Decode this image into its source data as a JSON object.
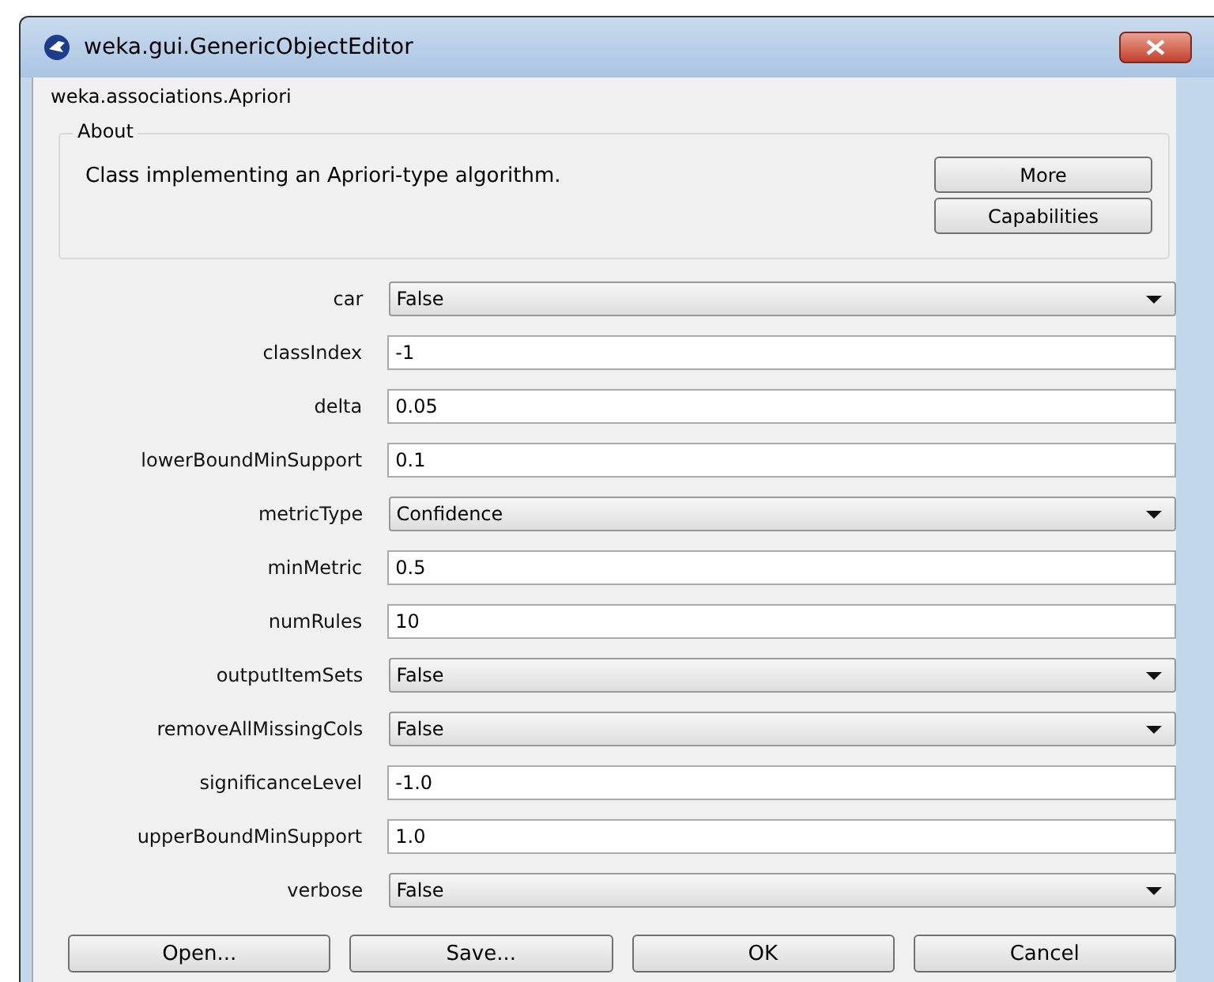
{
  "window": {
    "title": "weka.gui.GenericObjectEditor"
  },
  "class_name": "weka.associations.Apriori",
  "about": {
    "legend": "About",
    "description": "Class implementing an Apriori-type algorithm.",
    "buttons": [
      "More",
      "Capabilities"
    ]
  },
  "properties": [
    {
      "label": "car",
      "kind": "dropdown",
      "value": "False"
    },
    {
      "label": "classIndex",
      "kind": "text",
      "value": "-1"
    },
    {
      "label": "delta",
      "kind": "text",
      "value": "0.05"
    },
    {
      "label": "lowerBoundMinSupport",
      "kind": "text",
      "value": "0.1"
    },
    {
      "label": "metricType",
      "kind": "dropdown",
      "value": "Confidence"
    },
    {
      "label": "minMetric",
      "kind": "text",
      "value": "0.5"
    },
    {
      "label": "numRules",
      "kind": "text",
      "value": "10"
    },
    {
      "label": "outputItemSets",
      "kind": "dropdown",
      "value": "False"
    },
    {
      "label": "removeAllMissingCols",
      "kind": "dropdown",
      "value": "False"
    },
    {
      "label": "significanceLevel",
      "kind": "text",
      "value": "-1.0"
    },
    {
      "label": "upperBoundMinSupport",
      "kind": "text",
      "value": "1.0"
    },
    {
      "label": "verbose",
      "kind": "dropdown",
      "value": "False"
    }
  ],
  "buttons": [
    "Open...",
    "Save...",
    "OK",
    "Cancel"
  ]
}
